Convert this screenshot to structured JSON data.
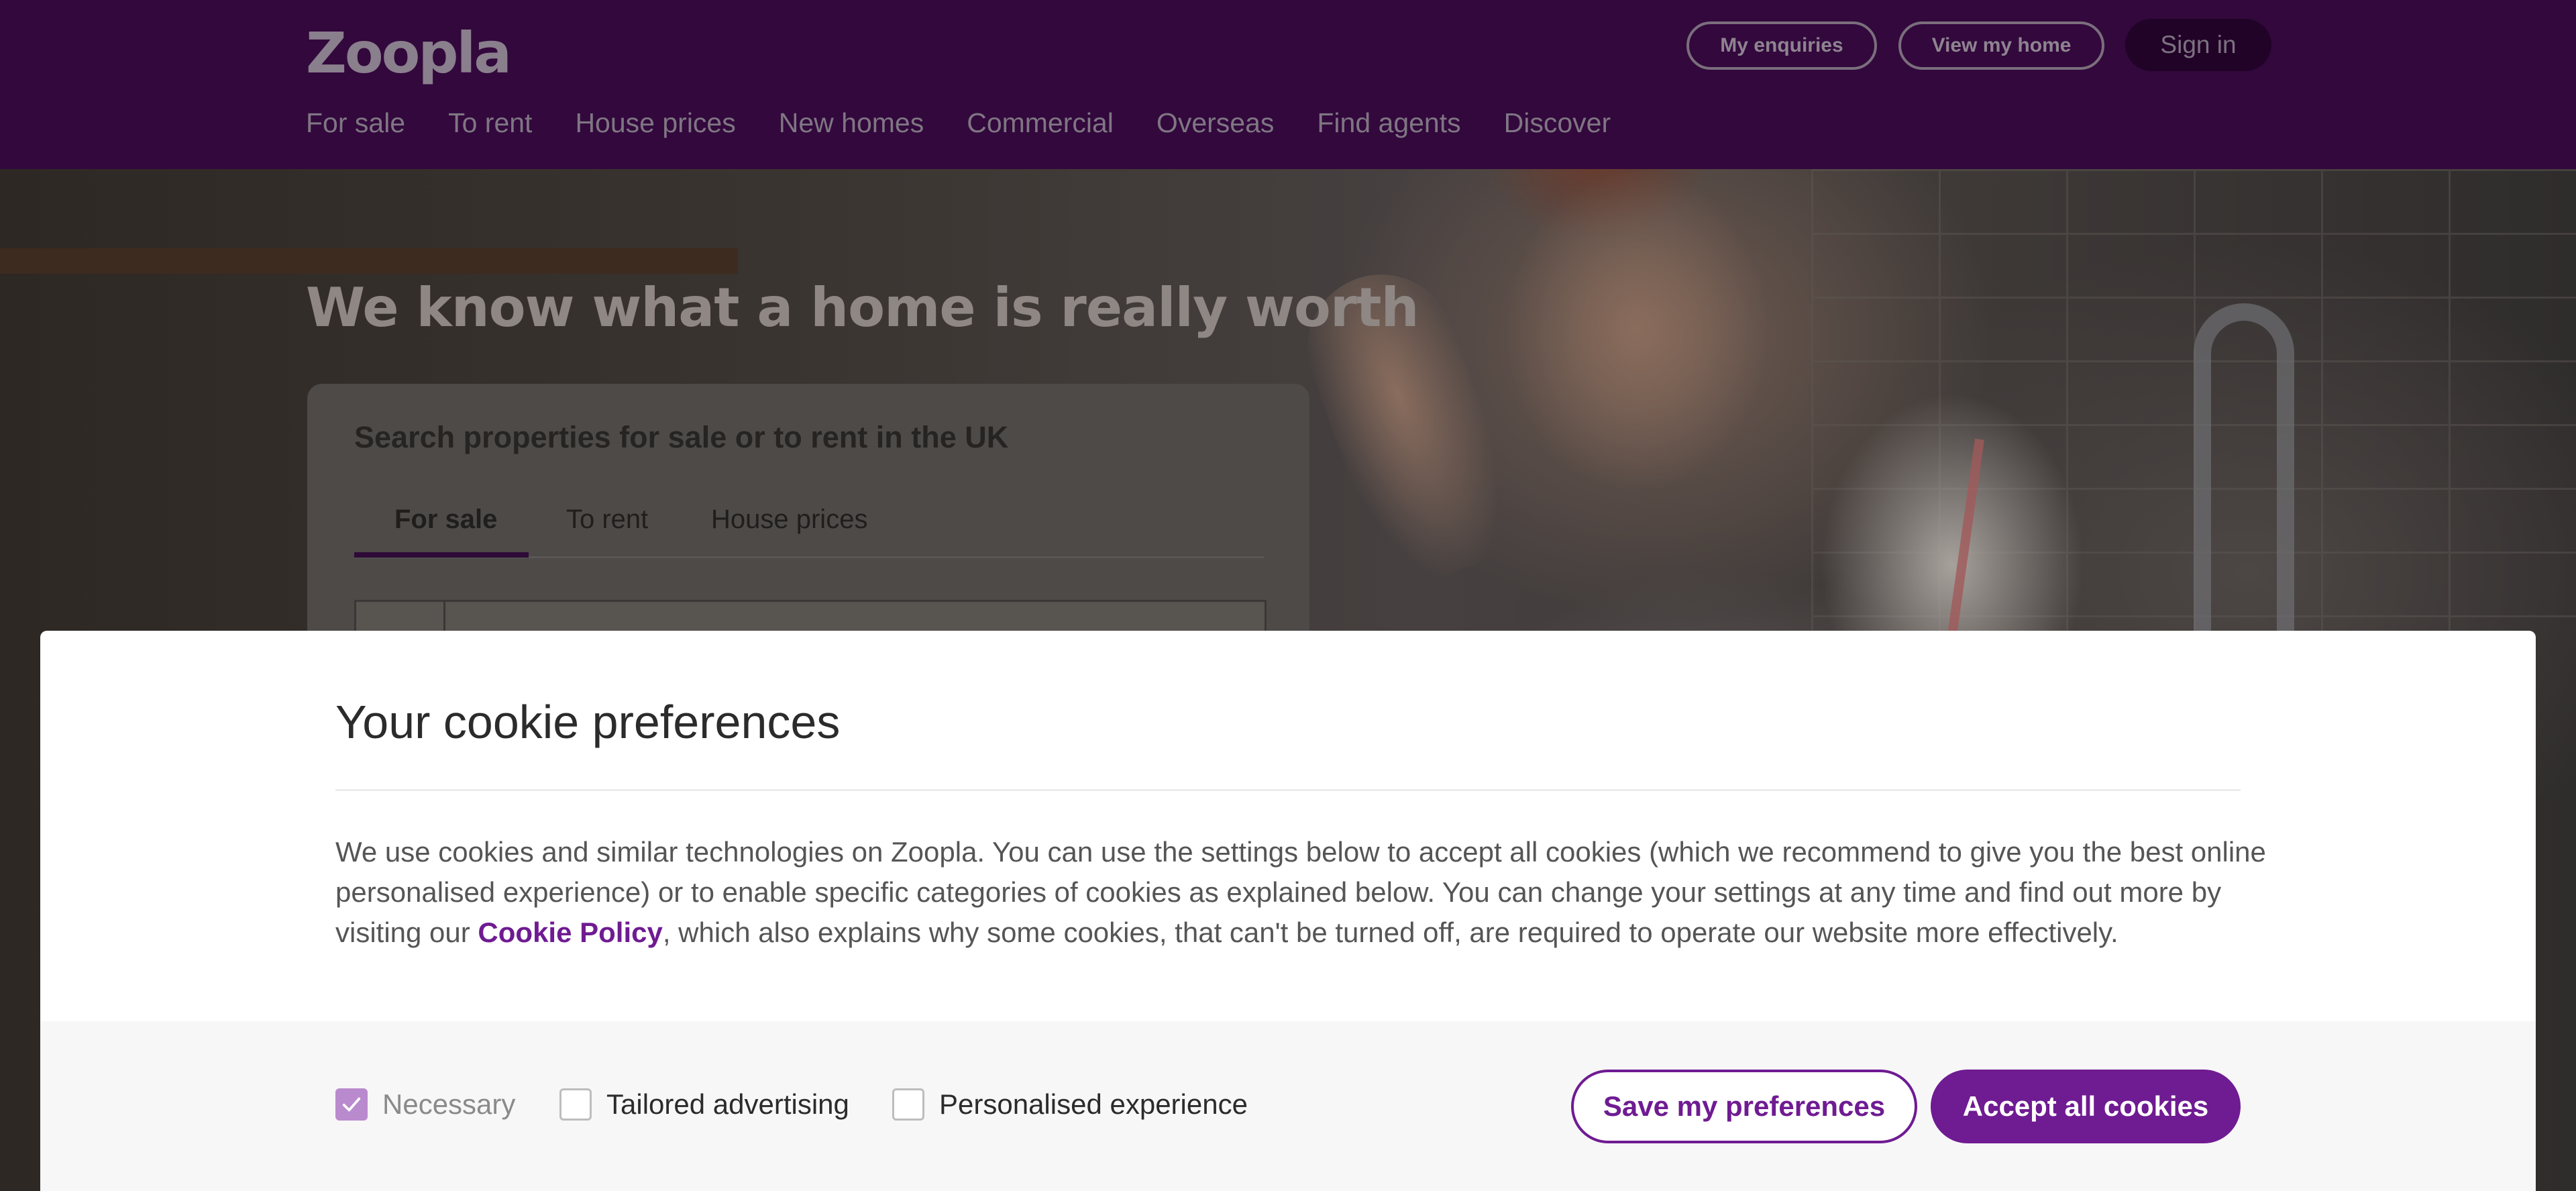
{
  "header": {
    "logo": "Zoopla",
    "buttons": {
      "enquiries": "My enquiries",
      "view_home": "View my home",
      "sign_in": "Sign in"
    },
    "nav": [
      "For sale",
      "To rent",
      "House prices",
      "New homes",
      "Commercial",
      "Overseas",
      "Find agents",
      "Discover"
    ]
  },
  "hero": {
    "title": "We know what a home is really worth",
    "search": {
      "heading": "Search properties for sale or to rent in the UK",
      "tabs": [
        "For sale",
        "To rent",
        "House prices"
      ],
      "active_tab": "For sale"
    }
  },
  "cookie_modal": {
    "title": "Your cookie preferences",
    "body_before_link": "We use cookies and similar technologies on Zoopla. You can use the settings below to accept all cookies (which we recommend to give you the best online personalised experience) or to enable specific categories of cookies as explained below. You can change your settings at any time and find out more by visiting our ",
    "link_text": "Cookie Policy",
    "body_after_link": ", which also explains why some cookies, that can't be turned off, are required to operate our website more effectively.",
    "options": [
      {
        "label": "Necessary",
        "checked": true,
        "disabled": true
      },
      {
        "label": "Tailored advertising",
        "checked": false
      },
      {
        "label": "Personalised experience",
        "checked": false
      }
    ],
    "save_label": "Save my preferences",
    "accept_label": "Accept all cookies"
  },
  "colors": {
    "header_bg": "#32083d",
    "brand_purple": "#6f1b92",
    "checked_box": "#b98acd"
  },
  "icons": {
    "checkmark": "check-icon"
  }
}
